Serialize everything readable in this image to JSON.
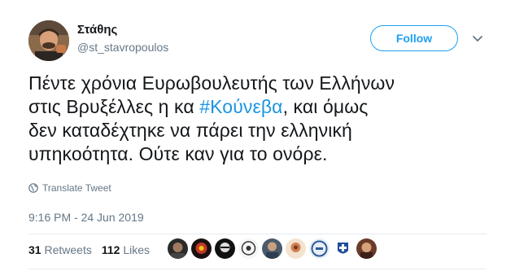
{
  "author": {
    "name": "Στάθης",
    "handle": "@st_stavropoulos"
  },
  "follow_label": "Follow",
  "tweet": {
    "line1": "Πέντε χρόνια Ευρωβουλευτής των Ελλήνων",
    "line2_pre": "στις Βρυξέλλες η κα ",
    "hashtag": "#Κούνεβα",
    "line2_post": ",  και όμως",
    "line3": "δεν καταδέχτηκε να πάρει την ελληνική",
    "line4": "υπηκοότητα. Ούτε καν για το ονόρε."
  },
  "translate_label": "Translate Tweet",
  "timestamp": "9:16 PM - 24 Jun 2019",
  "stats": {
    "retweets_count": "31",
    "retweets_label": "Retweets",
    "likes_count": "112",
    "likes_label": "Likes"
  },
  "colors": {
    "accent": "#1da1f2",
    "hashtag": "#1b95e0",
    "muted": "#657786"
  },
  "icons": {
    "translate": "globe-icon",
    "menu": "chevron-down-icon"
  }
}
